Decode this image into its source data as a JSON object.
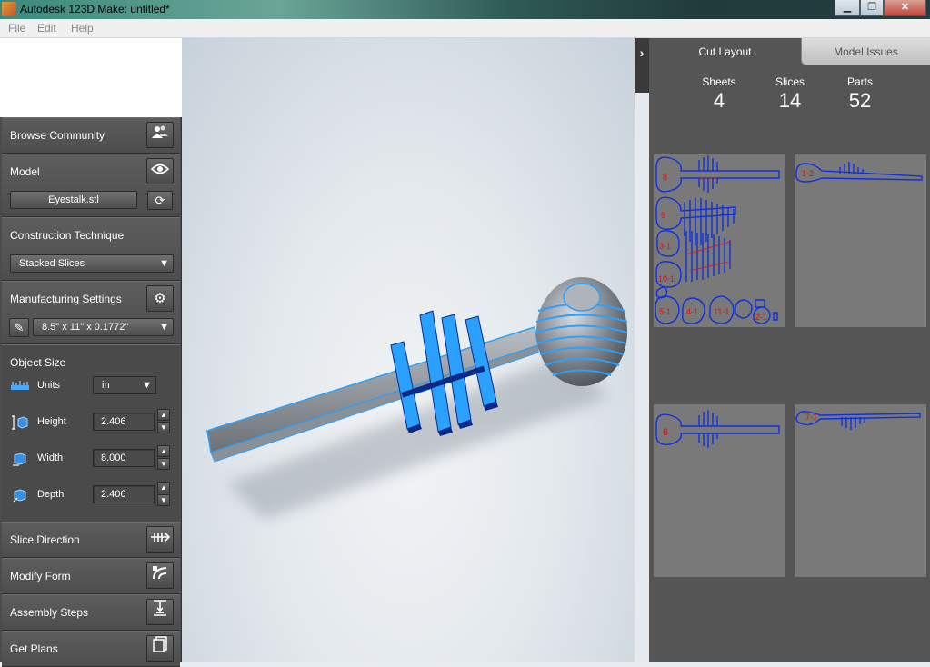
{
  "window": {
    "title": "Autodesk 123D Make: untitled*",
    "minimize": "▁",
    "maximize": "❐",
    "close": "✕"
  },
  "menu": {
    "file": "File",
    "edit": "Edit",
    "help": "Help"
  },
  "left": {
    "browse_community": {
      "label": "Browse Community",
      "icon": "people-icon"
    },
    "model": {
      "label": "Model",
      "file": "Eyestalk.stl",
      "icon": "eye-icon",
      "refresh_icon": "refresh-icon"
    },
    "construction": {
      "label": "Construction Technique",
      "value": "Stacked Slices"
    },
    "manufacturing": {
      "label": "Manufacturing Settings",
      "value": "8.5\" x 11\" x 0.1772\"",
      "icon": "gear-icon",
      "edit_icon": "pencil-icon"
    },
    "object_size": {
      "label": "Object Size",
      "units": {
        "label": "Units",
        "value": "in"
      },
      "height": {
        "label": "Height",
        "value": "2.406"
      },
      "width": {
        "label": "Width",
        "value": "8.000"
      },
      "depth": {
        "label": "Depth",
        "value": "2.406"
      }
    },
    "slice_direction": {
      "label": "Slice Direction",
      "icon": "slice-direction-icon"
    },
    "modify_form": {
      "label": "Modify Form",
      "icon": "modify-form-icon"
    },
    "assembly_steps": {
      "label": "Assembly Steps",
      "icon": "assembly-steps-icon"
    },
    "get_plans": {
      "label": "Get Plans",
      "icon": "get-plans-icon"
    }
  },
  "right": {
    "tabs": {
      "cut_layout": "Cut Layout",
      "model_issues": "Model Issues"
    },
    "stats": {
      "sheets_label": "Sheets",
      "sheets": "4",
      "slices_label": "Slices",
      "slices": "14",
      "parts_label": "Parts",
      "parts": "52"
    },
    "sheet_labels": {
      "s1a": "8",
      "s1b": "9",
      "s1c": "3-1",
      "s1d": "10-1",
      "s1e": "5-1",
      "s1f": "4-1",
      "s1g": "11-1",
      "s1h": "2-1",
      "s2": "1-2",
      "s3": "6",
      "s4": "7-1"
    }
  },
  "colors": {
    "part_outline": "#1030e0",
    "part_label": "#e01010",
    "model_blue": "#2aa0ff",
    "model_dark": "#0a2a8a"
  }
}
